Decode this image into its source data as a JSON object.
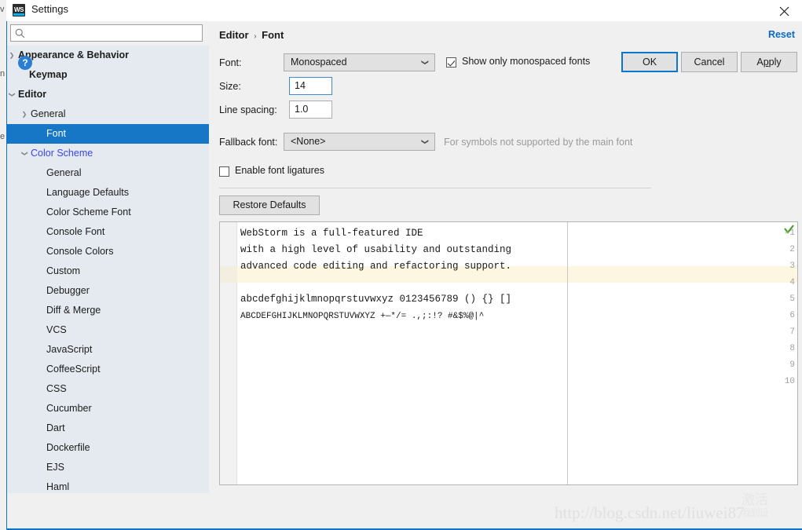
{
  "window": {
    "title": "Settings",
    "app_icon": "webstorm-icon",
    "close_icon": "close-icon"
  },
  "search": {
    "placeholder": "",
    "value": "",
    "icon": "search-icon"
  },
  "sidebar": {
    "items": [
      {
        "label": "Appearance & Behavior",
        "indent": 14,
        "twisty": "right",
        "bold": true,
        "selected": false,
        "link": false
      },
      {
        "label": "Keymap",
        "indent": 28,
        "twisty": "none",
        "bold": true,
        "selected": false,
        "link": false
      },
      {
        "label": "Editor",
        "indent": 14,
        "twisty": "down",
        "bold": true,
        "selected": false,
        "link": false
      },
      {
        "label": "General",
        "indent": 30,
        "twisty": "right",
        "bold": false,
        "selected": false,
        "link": false
      },
      {
        "label": "Font",
        "indent": 50,
        "twisty": "none",
        "bold": false,
        "selected": true,
        "link": false
      },
      {
        "label": "Color Scheme",
        "indent": 30,
        "twisty": "down",
        "bold": false,
        "selected": false,
        "link": true
      },
      {
        "label": "General",
        "indent": 50,
        "twisty": "none",
        "bold": false,
        "selected": false,
        "link": false
      },
      {
        "label": "Language Defaults",
        "indent": 50,
        "twisty": "none",
        "bold": false,
        "selected": false,
        "link": false
      },
      {
        "label": "Color Scheme Font",
        "indent": 50,
        "twisty": "none",
        "bold": false,
        "selected": false,
        "link": false
      },
      {
        "label": "Console Font",
        "indent": 50,
        "twisty": "none",
        "bold": false,
        "selected": false,
        "link": false
      },
      {
        "label": "Console Colors",
        "indent": 50,
        "twisty": "none",
        "bold": false,
        "selected": false,
        "link": false
      },
      {
        "label": "Custom",
        "indent": 50,
        "twisty": "none",
        "bold": false,
        "selected": false,
        "link": false
      },
      {
        "label": "Debugger",
        "indent": 50,
        "twisty": "none",
        "bold": false,
        "selected": false,
        "link": false
      },
      {
        "label": "Diff & Merge",
        "indent": 50,
        "twisty": "none",
        "bold": false,
        "selected": false,
        "link": false
      },
      {
        "label": "VCS",
        "indent": 50,
        "twisty": "none",
        "bold": false,
        "selected": false,
        "link": false
      },
      {
        "label": "JavaScript",
        "indent": 50,
        "twisty": "none",
        "bold": false,
        "selected": false,
        "link": false
      },
      {
        "label": "CoffeeScript",
        "indent": 50,
        "twisty": "none",
        "bold": false,
        "selected": false,
        "link": false
      },
      {
        "label": "CSS",
        "indent": 50,
        "twisty": "none",
        "bold": false,
        "selected": false,
        "link": false
      },
      {
        "label": "Cucumber",
        "indent": 50,
        "twisty": "none",
        "bold": false,
        "selected": false,
        "link": false
      },
      {
        "label": "Dart",
        "indent": 50,
        "twisty": "none",
        "bold": false,
        "selected": false,
        "link": false
      },
      {
        "label": "Dockerfile",
        "indent": 50,
        "twisty": "none",
        "bold": false,
        "selected": false,
        "link": false
      },
      {
        "label": "EJS",
        "indent": 50,
        "twisty": "none",
        "bold": false,
        "selected": false,
        "link": false
      },
      {
        "label": "Haml",
        "indent": 50,
        "twisty": "none",
        "bold": false,
        "selected": false,
        "link": false
      }
    ]
  },
  "pane": {
    "breadcrumb_parent": "Editor",
    "breadcrumb_sep": "›",
    "breadcrumb_current": "Font",
    "reset_label": "Reset",
    "font_label": "Font:",
    "font_value": "Monospaced",
    "size_label": "Size:",
    "size_value": "14",
    "line_spacing_label": "Line spacing:",
    "line_spacing_value": "1.0",
    "fallback_label": "Fallback font:",
    "fallback_value": "<None>",
    "fallback_hint": "For symbols not supported by the main font",
    "show_mono_label": "Show only monospaced fonts",
    "show_mono_checked": true,
    "ligatures_label": "Enable font ligatures",
    "ligatures_checked": false,
    "restore_defaults_label": "Restore Defaults"
  },
  "preview": {
    "inspection_icon": "green-check-icon",
    "caret_line": 4,
    "lines": [
      {
        "n": "1",
        "text": "WebStorm is a full-featured IDE",
        "small": false
      },
      {
        "n": "2",
        "text": "with a high level of usability and outstanding",
        "small": false
      },
      {
        "n": "3",
        "text": "advanced code editing and refactoring support.",
        "small": false
      },
      {
        "n": "4",
        "text": "",
        "small": false
      },
      {
        "n": "5",
        "text": "abcdefghijklmnopqrstuvwxyz 0123456789 () {} []",
        "small": false
      },
      {
        "n": "6",
        "text": "ABCDEFGHIJKLMNOPQRSTUVWXYZ +—*/= .,;:!? #&$%@|^",
        "small": true
      },
      {
        "n": "7",
        "text": "",
        "small": false
      },
      {
        "n": "8",
        "text": "",
        "small": false
      },
      {
        "n": "9",
        "text": "",
        "small": false
      },
      {
        "n": "10",
        "text": "",
        "small": false
      }
    ]
  },
  "footer": {
    "help_label": "?",
    "ok_label": "OK",
    "cancel_label": "Cancel",
    "apply_label_pre": "A",
    "apply_label_mnem": "p",
    "apply_label_post": "ply"
  },
  "watermarks": {
    "url": "http://blog.csdn.net/liuwei87",
    "cn_line1": "激活",
    "cn_line2": "我到设"
  },
  "colors": {
    "accent": "#0a76d0",
    "selection": "#1577c6",
    "sidebar_bg": "#e4eaef",
    "link": "#3a46e8",
    "caret_line": "#fdf7e2",
    "check_green": "#4a9a2f"
  }
}
